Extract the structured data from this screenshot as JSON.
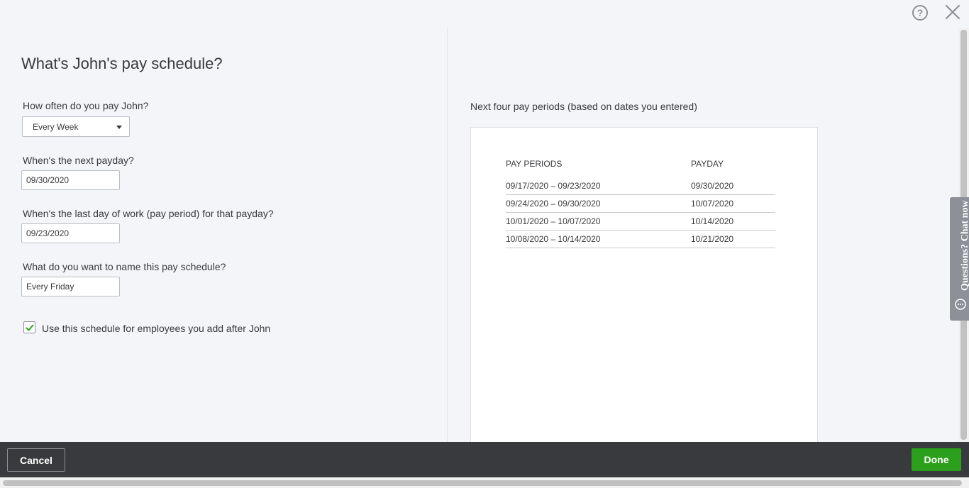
{
  "header": {
    "help_glyph": "?"
  },
  "form": {
    "title": "What's John's pay schedule?",
    "frequency": {
      "label": "How often do you pay John?",
      "value": "Every Week"
    },
    "next_payday": {
      "label": "When's the next payday?",
      "value": "09/30/2020"
    },
    "last_work_day": {
      "label": "When's the last day of work (pay period) for that payday?",
      "value": "09/23/2020"
    },
    "schedule_name": {
      "label": "What do you want to name this pay schedule?",
      "value": "Every Friday"
    },
    "apply_to_new": {
      "label": "Use this schedule for employees you add after John",
      "checked": true
    }
  },
  "preview": {
    "heading": "Next four pay periods (based on dates you entered)",
    "columns": [
      "PAY PERIODS",
      "PAYDAY"
    ],
    "rows": [
      {
        "period": "09/17/2020 – 09/23/2020",
        "payday": "09/30/2020"
      },
      {
        "period": "09/24/2020 – 09/30/2020",
        "payday": "10/07/2020"
      },
      {
        "period": "10/01/2020 – 10/07/2020",
        "payday": "10/14/2020"
      },
      {
        "period": "10/08/2020 – 10/14/2020",
        "payday": "10/21/2020"
      }
    ]
  },
  "chat": {
    "label": "Questions? Chat now"
  },
  "footer": {
    "cancel_label": "Cancel",
    "done_label": "Done"
  },
  "colors": {
    "accent_green": "#2ca01c",
    "footer_bg": "#393a3d",
    "page_bg": "#f4f5f8"
  }
}
